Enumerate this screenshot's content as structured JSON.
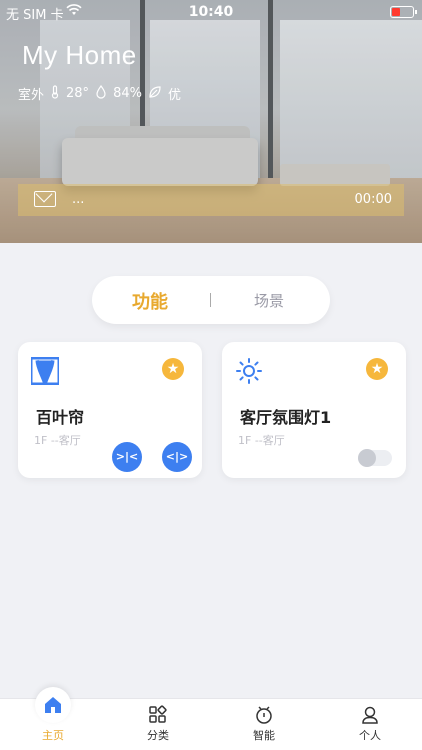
{
  "status_bar": {
    "carrier": "无 SIM 卡",
    "time": "10:40"
  },
  "header": {
    "title": "My Home",
    "weather": {
      "label": "室外",
      "temperature": "28°",
      "humidity": "84%",
      "air_quality": "优"
    }
  },
  "message": {
    "text": "...",
    "time": "00:00"
  },
  "tabs": [
    {
      "label": "功能"
    },
    {
      "label": "场景"
    }
  ],
  "devices": [
    {
      "name": "百叶帘",
      "location": "1F --客厅",
      "icon": "curtain-icon",
      "favorite": true
    },
    {
      "name": "客厅氛围灯1",
      "location": "1F --客厅",
      "icon": "light-icon",
      "favorite": true,
      "on": false
    }
  ],
  "bottom_nav": [
    {
      "label": "主页",
      "icon": "home-icon",
      "active": true
    },
    {
      "label": "分类",
      "icon": "category-icon"
    },
    {
      "label": "智能",
      "icon": "smart-icon"
    },
    {
      "label": "个人",
      "icon": "person-icon"
    }
  ],
  "colors": {
    "accent": "#e8a92f",
    "primary_blue": "#3d7ff0",
    "background": "#f0f1f5"
  }
}
